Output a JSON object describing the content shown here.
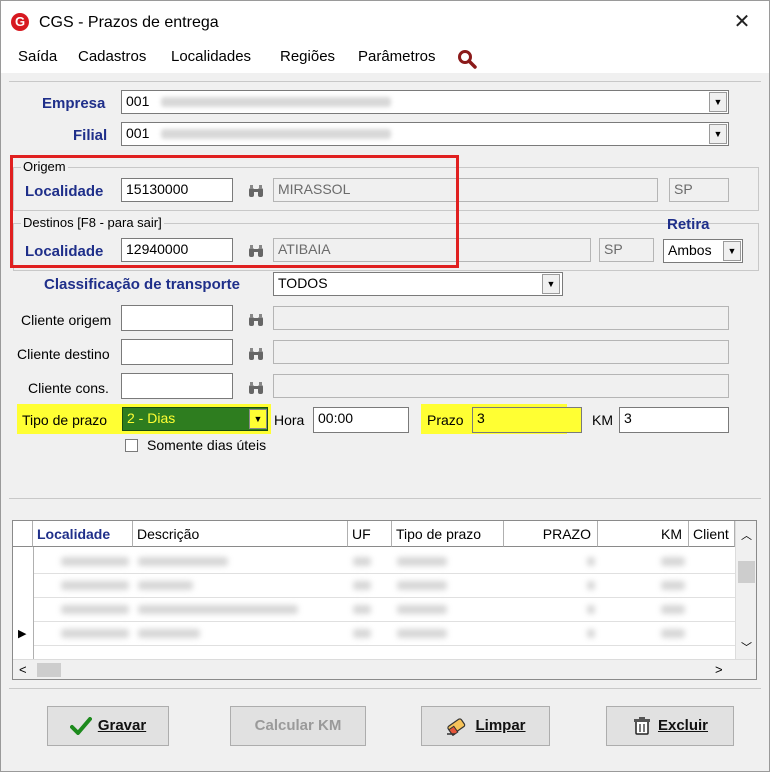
{
  "window": {
    "title": "CGS - Prazos de entrega",
    "logo_letter": "G",
    "close_glyph": "✕"
  },
  "menu": [
    "Saída",
    "Cadastros",
    "Localidades",
    "Regiões",
    "Parâmetros"
  ],
  "empresa": {
    "label": "Empresa",
    "code": "001"
  },
  "filial": {
    "label": "Filial",
    "code": "001"
  },
  "origem": {
    "group_title": "Origem",
    "label": "Localidade",
    "code": "15130000",
    "name": "MIRASSOL",
    "uf": "SP"
  },
  "destinos": {
    "group_title": "Destinos  [F8 - para sair]",
    "label": "Localidade",
    "code": "12940000",
    "name": "ATIBAIA",
    "uf": "SP"
  },
  "retira": {
    "label": "Retira",
    "value": "Ambos"
  },
  "classificacao": {
    "label": "Classificação de transporte",
    "value": "TODOS"
  },
  "cliente_origem": {
    "label": "Cliente origem",
    "value": ""
  },
  "cliente_destino": {
    "label": "Cliente destino",
    "value": ""
  },
  "cliente_cons": {
    "label": "Cliente cons.",
    "value": ""
  },
  "tipo_prazo": {
    "label": "Tipo de prazo",
    "value": "2 - Dias"
  },
  "hora": {
    "label": "Hora",
    "value": "00:00"
  },
  "prazo": {
    "label": "Prazo",
    "value": "3"
  },
  "km": {
    "label": "KM",
    "value": "3"
  },
  "somente_uteis": {
    "label": "Somente dias úteis",
    "checked": false
  },
  "grid": {
    "columns": [
      "Localidade",
      "Descrição",
      "UF",
      "Tipo de prazo",
      "PRAZO",
      "KM",
      "Client"
    ]
  },
  "buttons": {
    "gravar": "Gravar",
    "calcular": "Calcular KM",
    "limpar": "Limpar",
    "excluir": "Excluir"
  },
  "colors": {
    "highlight": "#ffff33",
    "red_box": "#e02020",
    "label_blue": "#1f2f8a",
    "selection_green": "#2e7d1f"
  }
}
